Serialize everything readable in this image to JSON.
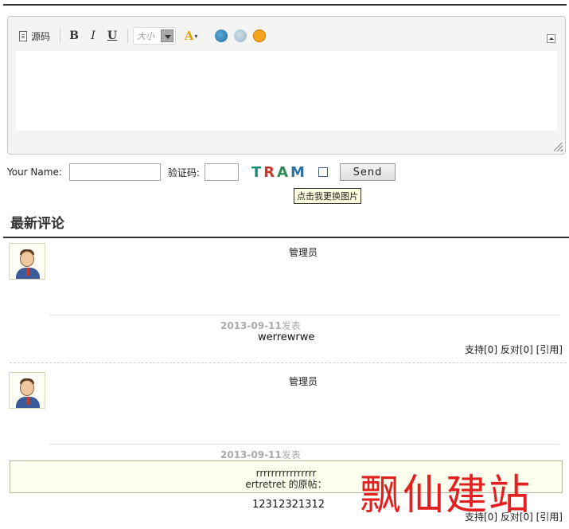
{
  "editor": {
    "toolbar": {
      "source_label": "源码",
      "bold_label": "B",
      "italic_label": "I",
      "underline_label": "U",
      "font_size_label": "大小",
      "font_color_label": "A"
    }
  },
  "form": {
    "name_label": "Your Name:",
    "name_value": "",
    "captcha_label": "验证码:",
    "captcha_value": "",
    "captcha_chars": [
      "T",
      "R",
      "A",
      "M"
    ],
    "send_label": "Send",
    "captcha_tooltip": "点击我更换图片"
  },
  "comments_section": {
    "title": "最新评论",
    "comments": [
      {
        "author": "管理员",
        "date": "2013-09-11",
        "date_suffix": "发表",
        "content": "werrewrwe",
        "actions": "支持[0] 反对[0] [引用]"
      },
      {
        "author": "管理员",
        "date": "2013-09-11",
        "date_suffix": "发表",
        "quote_text": "rrrrrrrrrrrrrrrr",
        "quote_source": "ertretret 的原帖：",
        "content": "12312321312",
        "actions": "支持[0] 反对[0] [引用]"
      }
    ]
  },
  "watermark": "飘仙建站"
}
